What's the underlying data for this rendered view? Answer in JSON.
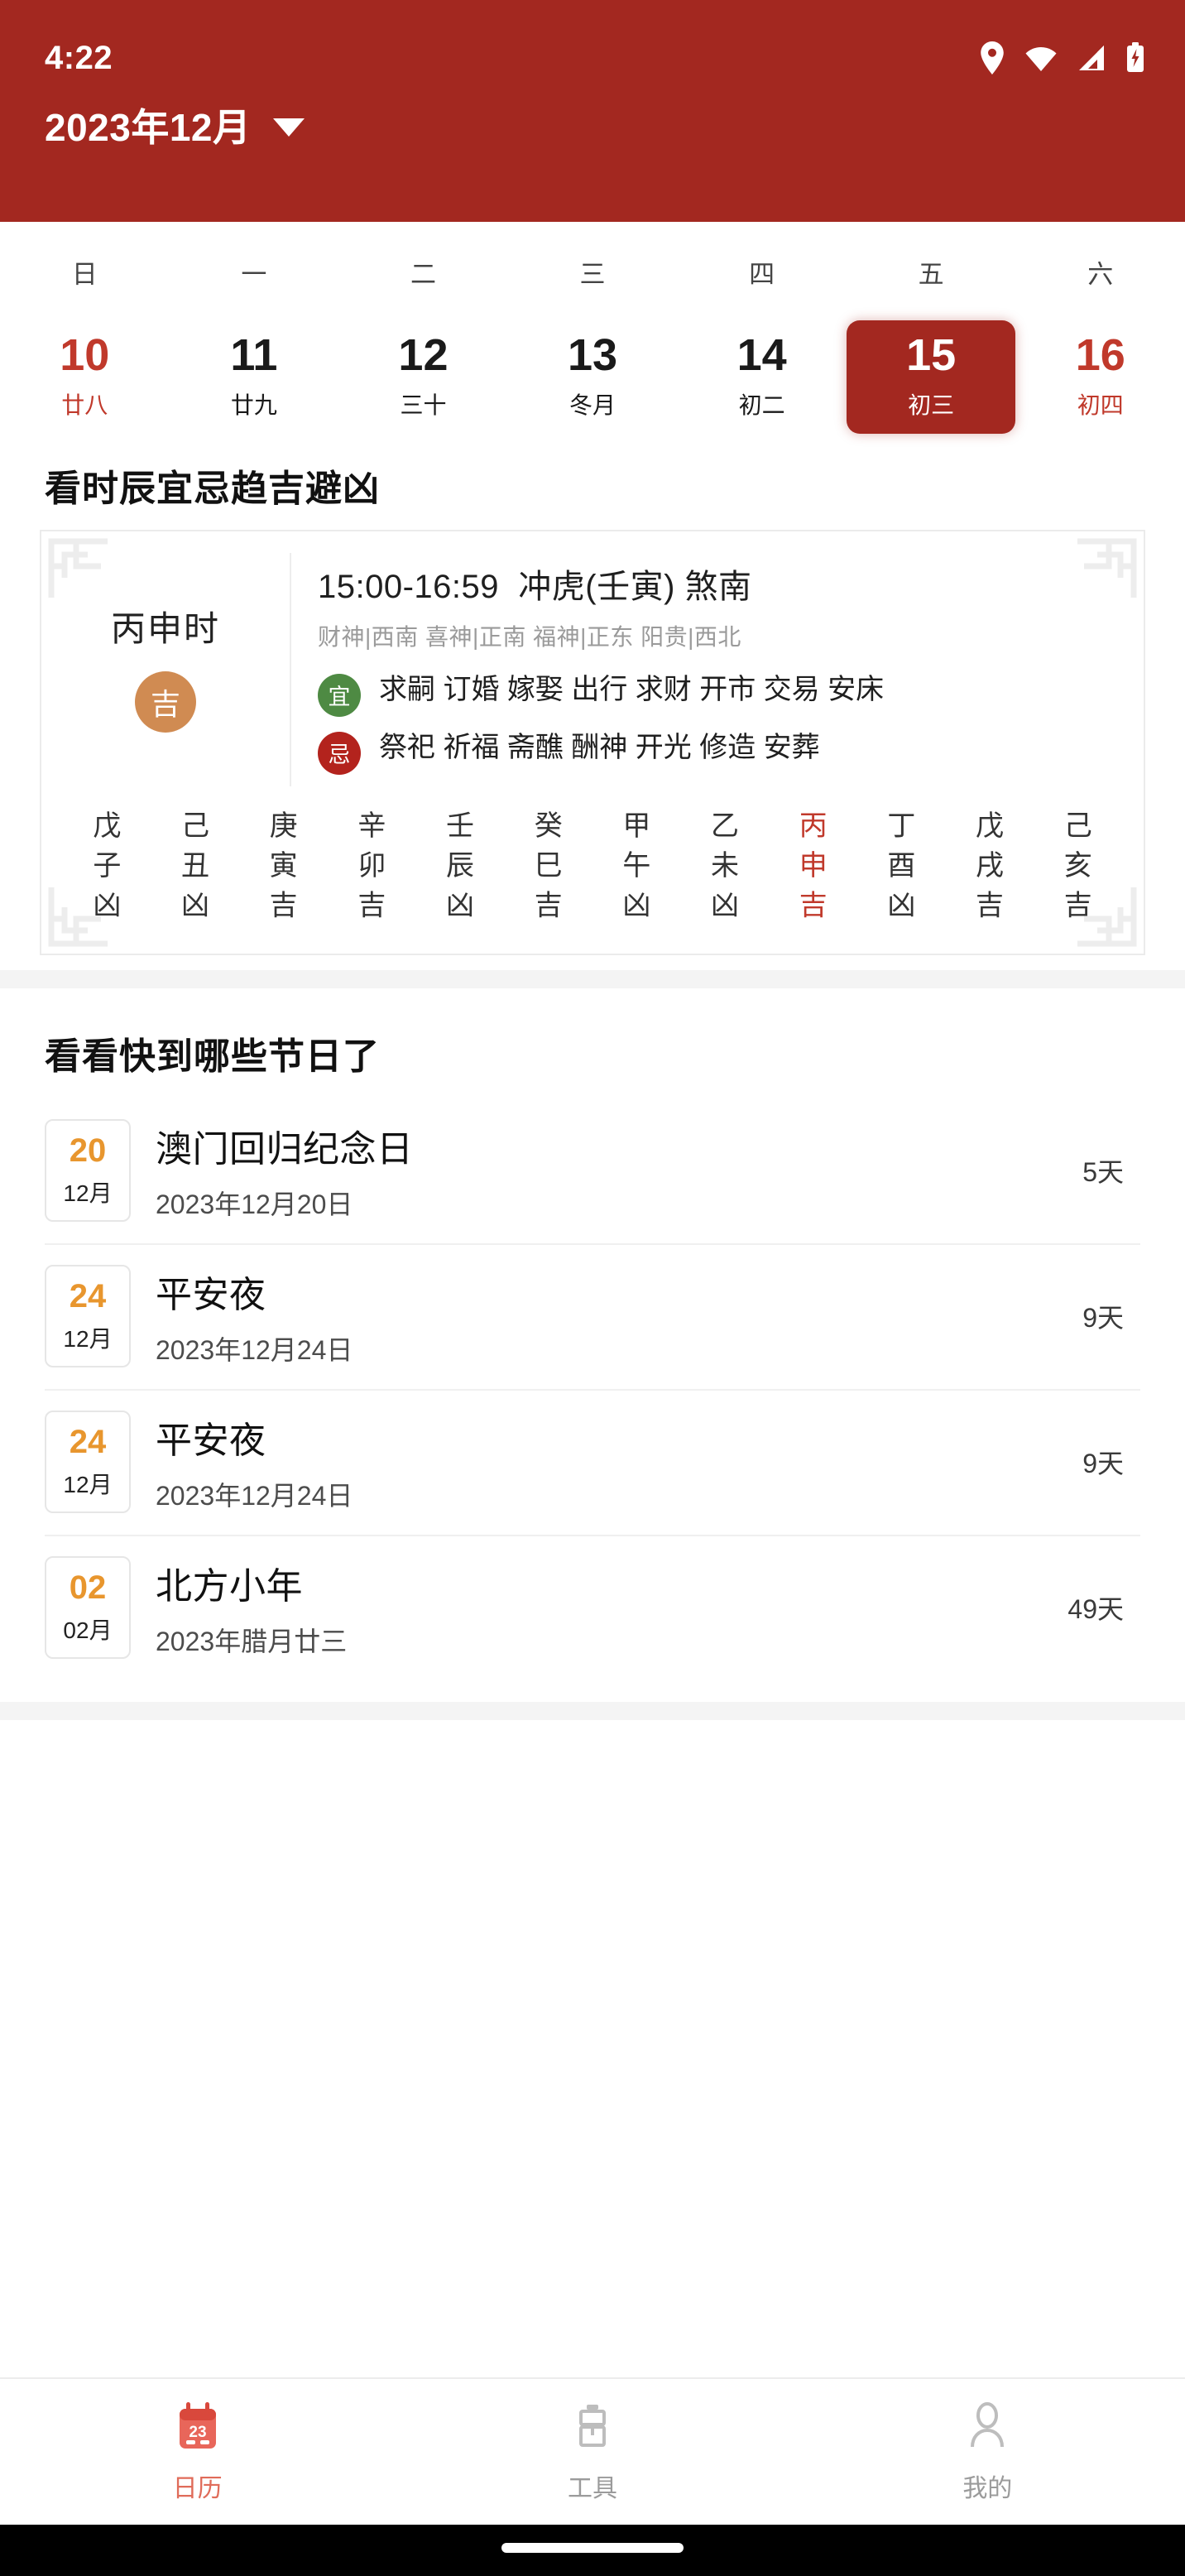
{
  "statusbar": {
    "time": "4:22",
    "icons": [
      "location-pin-icon",
      "wifi-icon",
      "signal-icon",
      "battery-charging-icon"
    ]
  },
  "appbar": {
    "title": "2023年12月",
    "dropdown_icon": "chevron-down-icon",
    "bg_color": "#A32820"
  },
  "weekdays": [
    "日",
    "一",
    "二",
    "三",
    "四",
    "五",
    "六"
  ],
  "dates": [
    {
      "num": "10",
      "lunar": "廿八",
      "weekend": true,
      "selected": false
    },
    {
      "num": "11",
      "lunar": "廿九",
      "weekend": false,
      "selected": false
    },
    {
      "num": "12",
      "lunar": "三十",
      "weekend": false,
      "selected": false
    },
    {
      "num": "13",
      "lunar": "冬月",
      "weekend": false,
      "selected": false
    },
    {
      "num": "14",
      "lunar": "初二",
      "weekend": false,
      "selected": false
    },
    {
      "num": "15",
      "lunar": "初三",
      "weekend": false,
      "selected": true
    },
    {
      "num": "16",
      "lunar": "初四",
      "weekend": true,
      "selected": false
    }
  ],
  "fortune": {
    "section_title": "看时辰宜忌趋吉避凶",
    "hour_name": "丙申时",
    "luck_badge": "吉",
    "luck_badge_color": "#D08B52",
    "time_range": "15:00-16:59",
    "clash": "冲虎(壬寅) 煞南",
    "gods": "财神|西南 喜神|正南 福神|正东 阳贵|西北",
    "yi_label": "宜",
    "yi_items": "求嗣 订婚 嫁娶 出行 求财 开市 交易 安床",
    "ji_label": "忌",
    "ji_items": "祭祀 祈福 斋醮 酬神 开光 修造 安葬",
    "hours": [
      {
        "stem": "戊",
        "branch": "子",
        "luck": "凶",
        "highlight": false
      },
      {
        "stem": "己",
        "branch": "丑",
        "luck": "凶",
        "highlight": false
      },
      {
        "stem": "庚",
        "branch": "寅",
        "luck": "吉",
        "highlight": false
      },
      {
        "stem": "辛",
        "branch": "卯",
        "luck": "吉",
        "highlight": false
      },
      {
        "stem": "壬",
        "branch": "辰",
        "luck": "凶",
        "highlight": false
      },
      {
        "stem": "癸",
        "branch": "巳",
        "luck": "吉",
        "highlight": false
      },
      {
        "stem": "甲",
        "branch": "午",
        "luck": "凶",
        "highlight": false
      },
      {
        "stem": "乙",
        "branch": "未",
        "luck": "凶",
        "highlight": false
      },
      {
        "stem": "丙",
        "branch": "申",
        "luck": "吉",
        "highlight": true
      },
      {
        "stem": "丁",
        "branch": "酉",
        "luck": "凶",
        "highlight": false
      },
      {
        "stem": "戊",
        "branch": "戌",
        "luck": "吉",
        "highlight": false
      },
      {
        "stem": "己",
        "branch": "亥",
        "luck": "吉",
        "highlight": false
      }
    ]
  },
  "holidays": {
    "section_title": "看看快到哪些节日了",
    "items": [
      {
        "day": "20",
        "month": "12月",
        "name": "澳门回归纪念日",
        "date": "2023年12月20日",
        "countdown": "5天"
      },
      {
        "day": "24",
        "month": "12月",
        "name": "平安夜",
        "date": "2023年12月24日",
        "countdown": "9天"
      },
      {
        "day": "24",
        "month": "12月",
        "name": "平安夜",
        "date": "2023年12月24日",
        "countdown": "9天"
      },
      {
        "day": "02",
        "month": "02月",
        "name": "北方小年",
        "date": "2023年腊月廿三",
        "countdown": "49天"
      }
    ]
  },
  "bottomnav": {
    "items": [
      {
        "label": "日历",
        "icon": "calendar-icon",
        "active": true
      },
      {
        "label": "工具",
        "icon": "toolbox-icon",
        "active": false
      },
      {
        "label": "我的",
        "icon": "person-icon",
        "active": false
      }
    ],
    "active_color": "#E06C5A",
    "inactive_color": "#9b9b9b"
  }
}
